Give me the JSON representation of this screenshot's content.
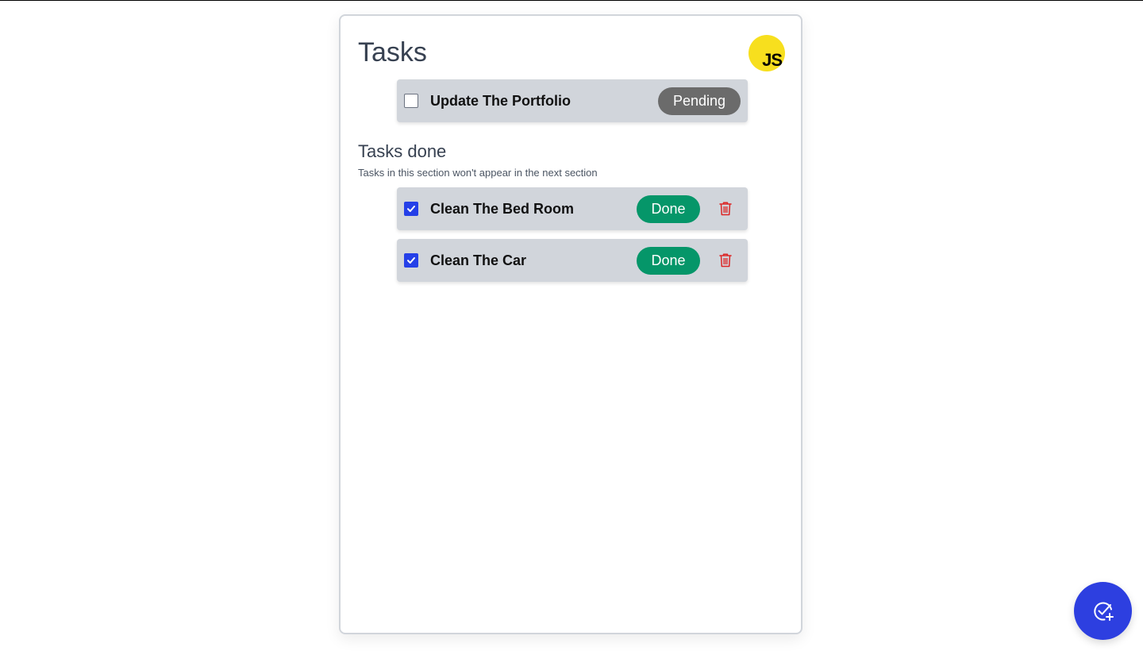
{
  "header": {
    "title": "Tasks",
    "logo_text": "JS"
  },
  "pending_tasks": [
    {
      "label": "Update The Portfolio",
      "status": "Pending",
      "checked": false
    }
  ],
  "done_section": {
    "title": "Tasks done",
    "subtitle": "Tasks in this section won't appear in the next section"
  },
  "done_tasks": [
    {
      "label": "Clean The Bed Room",
      "status": "Done",
      "checked": true
    },
    {
      "label": "Clean The Car",
      "status": "Done",
      "checked": true
    }
  ],
  "icons": {
    "delete": "trash-icon",
    "add_task": "check-plus-icon"
  },
  "colors": {
    "pending_badge": "#6b6b6b",
    "done_badge": "#059669",
    "checkbox_checked": "#2540e8",
    "fab": "#2d3fe0",
    "trash": "#dc2626",
    "js_logo": "#f7df1e"
  }
}
